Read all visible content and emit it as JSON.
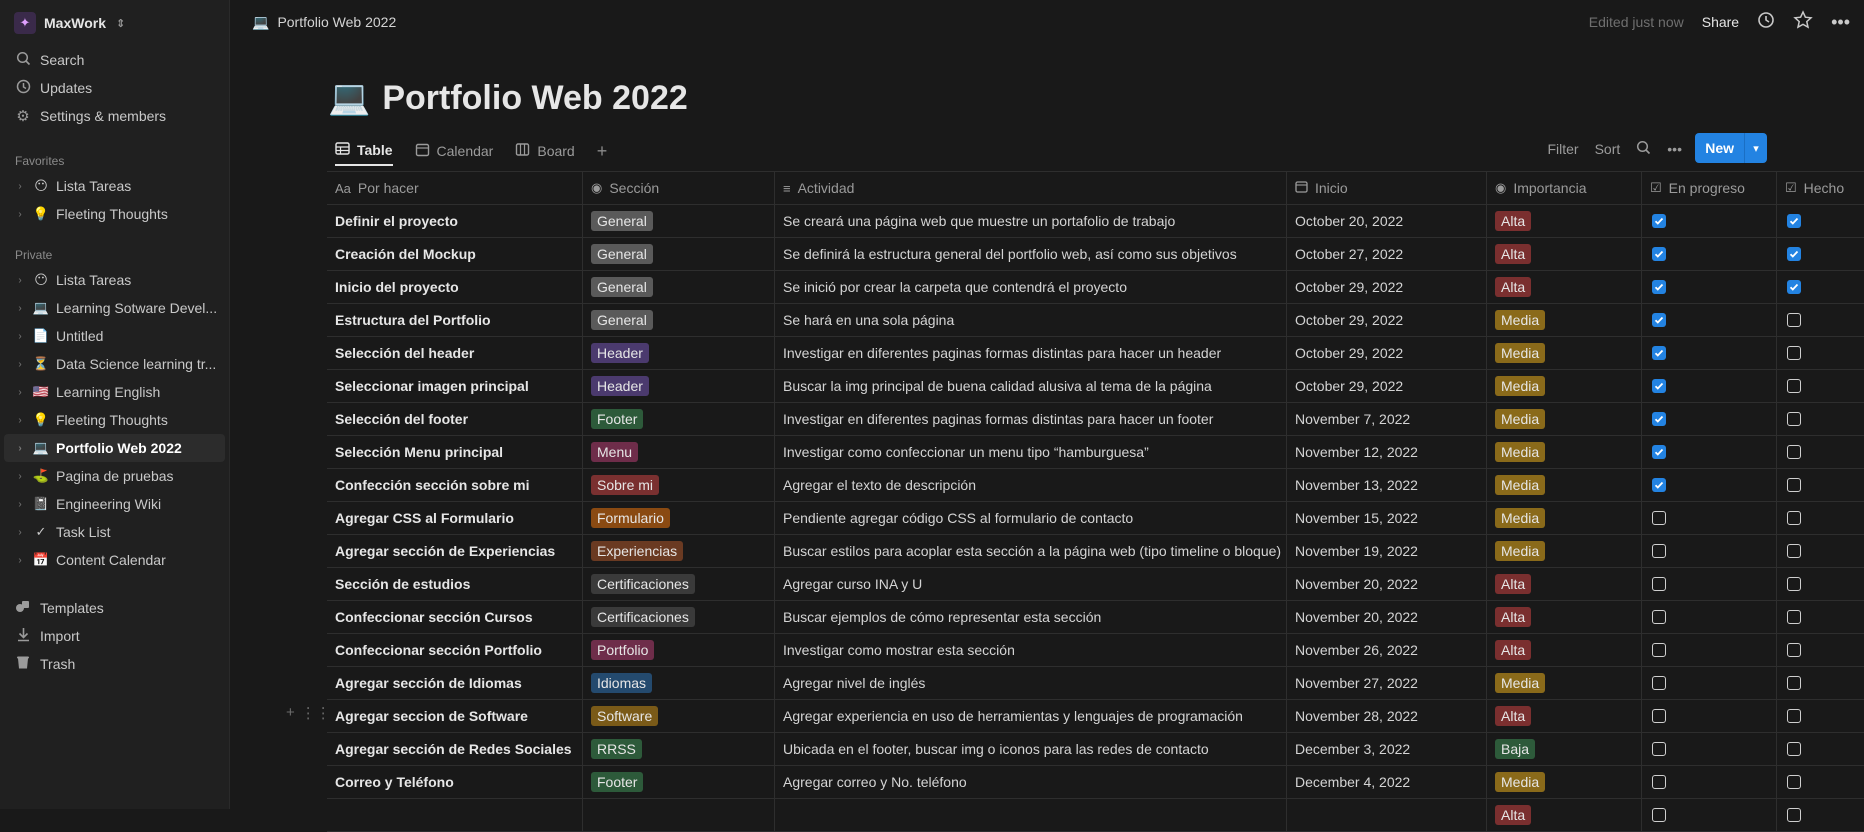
{
  "workspace": {
    "name": "MaxWork"
  },
  "sidebar": {
    "top": [
      {
        "label": "Search",
        "icon": "search-icon"
      },
      {
        "label": "Updates",
        "icon": "clock-icon"
      },
      {
        "label": "Settings & members",
        "icon": "gear-icon"
      }
    ],
    "favorites_label": "Favorites",
    "favorites": [
      {
        "label": "Lista Tareas",
        "emoji": "😶"
      },
      {
        "label": "Fleeting Thoughts",
        "emoji": "💡"
      }
    ],
    "private_label": "Private",
    "private": [
      {
        "label": "Lista Tareas",
        "emoji": "😶"
      },
      {
        "label": "Learning Sotware Devel...",
        "emoji": "💻"
      },
      {
        "label": "Untitled",
        "emoji": "📄"
      },
      {
        "label": "Data Science learning tr...",
        "emoji": "⏳"
      },
      {
        "label": "Learning English",
        "emoji": "🇺🇸"
      },
      {
        "label": "Fleeting Thoughts",
        "emoji": "💡"
      },
      {
        "label": "Portfolio Web 2022",
        "emoji": "💻"
      },
      {
        "label": "Pagina de pruebas",
        "emoji": "⛳"
      },
      {
        "label": "Engineering Wiki",
        "emoji": "📓"
      },
      {
        "label": "Task List",
        "emoji": "✓"
      },
      {
        "label": "Content Calendar",
        "emoji": "📅"
      }
    ],
    "bottom": [
      {
        "label": "Templates",
        "icon": "templates-icon"
      },
      {
        "label": "Import",
        "icon": "import-icon"
      },
      {
        "label": "Trash",
        "icon": "trash-icon"
      }
    ]
  },
  "topbar": {
    "breadcrumb": "Portfolio Web 2022",
    "edited": "Edited just now",
    "share": "Share"
  },
  "page": {
    "emoji": "💻",
    "title": "Portfolio Web 2022"
  },
  "views": {
    "tabs": [
      "Table",
      "Calendar",
      "Board"
    ],
    "filter": "Filter",
    "sort": "Sort",
    "new": "New"
  },
  "table": {
    "headers": {
      "name": "Por hacer",
      "name_prefix": "Aa",
      "seccion": "Sección",
      "actividad": "Actividad",
      "inicio": "Inicio",
      "importancia": "Importancia",
      "progreso": "En progreso",
      "hecho": "Hecho"
    },
    "rows": [
      {
        "name": "Definir el proyecto",
        "seccion": "General",
        "actividad": "Se creará una página web que muestre un portafolio de trabajo",
        "inicio": "October 20, 2022",
        "importancia": "Alta",
        "progreso": true,
        "hecho": true
      },
      {
        "name": "Creación del Mockup",
        "seccion": "General",
        "actividad": "Se definirá la estructura general del portfolio web, así como sus objetivos",
        "inicio": "October 27, 2022",
        "importancia": "Alta",
        "progreso": true,
        "hecho": true
      },
      {
        "name": "Inicio del proyecto",
        "seccion": "General",
        "actividad": "Se inició por crear la carpeta que contendrá el proyecto",
        "inicio": "October 29, 2022",
        "importancia": "Alta",
        "progreso": true,
        "hecho": true
      },
      {
        "name": "Estructura del Portfolio",
        "seccion": "General",
        "actividad": "Se hará en una sola página",
        "inicio": "October 29, 2022",
        "importancia": "Media",
        "progreso": true,
        "hecho": false
      },
      {
        "name": "Selección del header",
        "seccion": "Header",
        "actividad": "Investigar en diferentes paginas formas distintas para hacer un header",
        "inicio": "October 29, 2022",
        "importancia": "Media",
        "progreso": true,
        "hecho": false
      },
      {
        "name": "Seleccionar imagen principal",
        "seccion": "Header",
        "actividad": "Buscar la img principal de buena calidad alusiva al tema de la página",
        "inicio": "October 29, 2022",
        "importancia": "Media",
        "progreso": true,
        "hecho": false
      },
      {
        "name": "Selección del footer",
        "seccion": "Footer",
        "actividad": "Investigar en diferentes paginas formas distintas para hacer un footer",
        "inicio": "November 7, 2022",
        "importancia": "Media",
        "progreso": true,
        "hecho": false
      },
      {
        "name": "Selección Menu principal",
        "seccion": "Menu",
        "actividad": "Investigar como confeccionar un menu tipo “hamburguesa”",
        "inicio": "November 12, 2022",
        "importancia": "Media",
        "progreso": true,
        "hecho": false
      },
      {
        "name": "Confección sección sobre mi",
        "seccion": "Sobre mi",
        "actividad": "Agregar el texto de descripción",
        "inicio": "November 13, 2022",
        "importancia": "Media",
        "progreso": true,
        "hecho": false
      },
      {
        "name": "Agregar CSS al Formulario",
        "seccion": "Formulario",
        "actividad": "Pendiente agregar código CSS al formulario de contacto",
        "inicio": "November 15, 2022",
        "importancia": "Media",
        "progreso": false,
        "hecho": false
      },
      {
        "name": "Agregar sección de Experiencias",
        "seccion": "Experiencias",
        "actividad": "Buscar estilos para acoplar esta sección a la página web (tipo timeline o bloque)",
        "inicio": "November 19, 2022",
        "importancia": "Media",
        "progreso": false,
        "hecho": false
      },
      {
        "name": "Sección de estudios",
        "seccion": "Certificaciones",
        "actividad": "Agregar curso INA y U",
        "inicio": "November 20, 2022",
        "importancia": "Alta",
        "progreso": false,
        "hecho": false
      },
      {
        "name": "Confeccionar sección Cursos",
        "seccion": "Certificaciones",
        "actividad": "Buscar ejemplos de cómo representar esta sección",
        "inicio": "November 20, 2022",
        "importancia": "Alta",
        "progreso": false,
        "hecho": false
      },
      {
        "name": "Confeccionar sección Portfolio",
        "seccion": "Portfolio",
        "actividad": "Investigar como mostrar esta sección",
        "inicio": "November 26, 2022",
        "importancia": "Alta",
        "progreso": false,
        "hecho": false
      },
      {
        "name": "Agregar sección de Idiomas",
        "seccion": "Idiomas",
        "actividad": "Agregar nivel de inglés",
        "inicio": "November 27, 2022",
        "importancia": "Media",
        "progreso": false,
        "hecho": false
      },
      {
        "name": "Agregar seccion de Software",
        "seccion": "Software",
        "actividad": "Agregar experiencia en uso de herramientas y lenguajes de programación",
        "inicio": "November 28, 2022",
        "importancia": "Alta",
        "progreso": false,
        "hecho": false
      },
      {
        "name": "Agregar sección de Redes Sociales",
        "seccion": "RRSS",
        "actividad": "Ubicada en el footer, buscar img o iconos para las redes de contacto",
        "inicio": "December 3, 2022",
        "importancia": "Baja",
        "progreso": false,
        "hecho": false
      },
      {
        "name": "Correo y Teléfono",
        "seccion": "Footer",
        "actividad": "Agregar correo y No. teléfono",
        "inicio": "December 4, 2022",
        "importancia": "Media",
        "progreso": false,
        "hecho": false
      },
      {
        "name": "",
        "seccion": "",
        "actividad": "",
        "inicio": "",
        "importancia": "Alta",
        "progreso": false,
        "hecho": false
      }
    ]
  },
  "colors": {
    "accent": "#2383e2",
    "section_tags": {
      "General": "#5a5a5a",
      "Header": "#4b3a6e",
      "Footer": "#2d5a3a",
      "Menu": "#6e2d4a",
      "Sobre mi": "#7a3030",
      "Formulario": "#8a4a12",
      "Experiencias": "#6a3a22",
      "Certificaciones": "#3a3a3a",
      "Portfolio": "#6e2d4a",
      "Idiomas": "#244a6e",
      "Software": "#7a5a18",
      "RRSS": "#2d5a3a"
    },
    "importance_tags": {
      "Alta": "#7a2f2f",
      "Media": "#8a6a1a",
      "Baja": "#2d5a3a"
    }
  }
}
